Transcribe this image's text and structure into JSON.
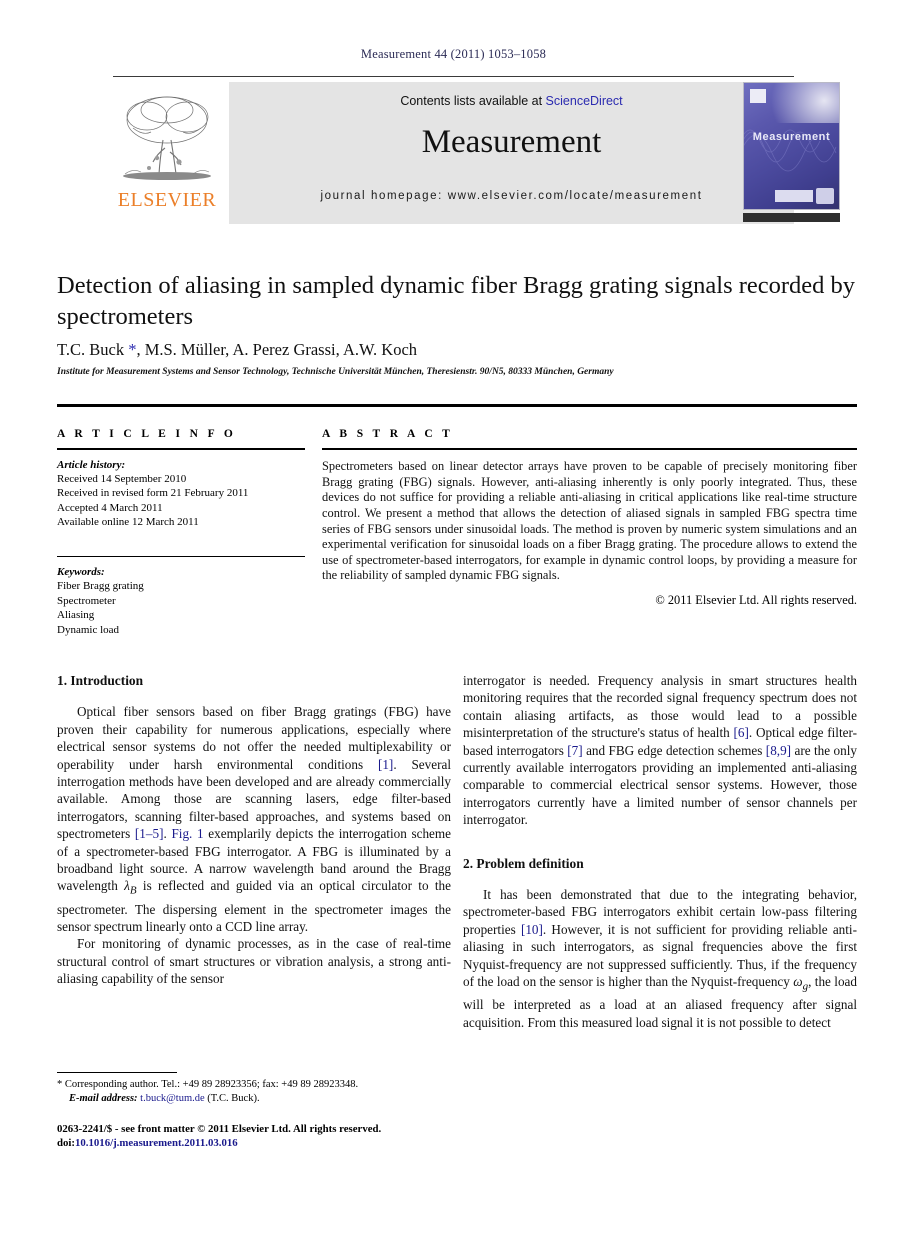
{
  "running_head": "Measurement 44 (2011) 1053–1058",
  "masthead": {
    "contents_prefix": "Contents lists available at ",
    "contents_link": "ScienceDirect",
    "journal_title": "Measurement",
    "homepage": "journal homepage: www.elsevier.com/locate/measurement",
    "publisher_logo_text": "ELSEVIER",
    "cover_title": "Measurement"
  },
  "article": {
    "title": "Detection of aliasing in sampled dynamic fiber Bragg grating signals recorded by spectrometers",
    "authors": "T.C. Buck ",
    "author_star": "*",
    "authors_rest": ", M.S. Müller, A. Perez Grassi, A.W. Koch",
    "affiliation": "Institute for Measurement Systems and Sensor Technology, Technische Universität München, Theresienstr. 90/N5, 80333 München, Germany"
  },
  "info": {
    "heading": "A R T I C L E   I N F O",
    "history_label": "Article history:",
    "history": [
      "Received 14 September 2010",
      "Received in revised form 21 February 2011",
      "Accepted 4 March 2011",
      "Available online 12 March 2011"
    ],
    "keywords_label": "Keywords:",
    "keywords": [
      "Fiber Bragg grating",
      "Spectrometer",
      "Aliasing",
      "Dynamic load"
    ]
  },
  "abstract": {
    "heading": "A B S T R A C T",
    "text": "Spectrometers based on linear detector arrays have proven to be capable of precisely monitoring fiber Bragg grating (FBG) signals. However, anti-aliasing inherently is only poorly integrated. Thus, these devices do not suffice for providing a reliable anti-aliasing in critical applications like real-time structure control. We present a method that allows the detection of aliased signals in sampled FBG spectra time series of FBG sensors under sinusoidal loads. The method is proven by numeric system simulations and an experimental verification for sinusoidal loads on a fiber Bragg grating. The procedure allows to extend the use of spectrometer-based interrogators, for example in dynamic control loops, by providing a measure for the reliability of sampled dynamic FBG signals.",
    "copyright": "© 2011 Elsevier Ltd. All rights reserved."
  },
  "body": {
    "section1_title": "1. Introduction",
    "s1_p1_a": "Optical fiber sensors based on fiber Bragg gratings (FBG) have proven their capability for numerous applications, especially where electrical sensor systems do not offer the needed multiplexability or operability under harsh environmental conditions ",
    "s1_p1_ref1": "[1]",
    "s1_p1_b": ". Several interrogation methods have been developed and are already commercially available. Among those are scanning lasers, edge filter-based interrogators, scanning filter-based approaches, and systems based on spectrometers ",
    "s1_p1_ref2": "[1–5]",
    "s1_p1_c": ". ",
    "s1_p1_ref3": "Fig. 1",
    "s1_p1_d": " exemplarily depicts the interrogation scheme of a spectrometer-based FBG interrogator. A FBG is illuminated by a broadband light source. A narrow wavelength band around the Bragg wavelength ",
    "s1_p1_sym": "λ",
    "s1_p1_sub": "B",
    "s1_p1_e": " is reflected and guided via an optical circulator to the spectrometer. The dispersing element in the spectrometer images the sensor spectrum linearly onto a CCD line array.",
    "s1_p2": "For monitoring of dynamic processes, as in the case of real-time structural control of smart structures or vibration analysis, a strong anti-aliasing capability of the sensor",
    "s1_p3_a": "interrogator is needed. Frequency analysis in smart structures health monitoring requires that the recorded signal frequency spectrum does not contain aliasing artifacts, as those would lead to a possible misinterpretation of the structure's status of health ",
    "s1_p3_ref6": "[6]",
    "s1_p3_b": ". Optical edge filter-based interrogators ",
    "s1_p3_ref7": "[7]",
    "s1_p3_c": " and FBG edge detection schemes ",
    "s1_p3_ref89": "[8,9]",
    "s1_p3_d": " are the only currently available interrogators providing an implemented anti-aliasing comparable to commercial electrical sensor systems. However, those interrogators currently have a limited number of sensor channels per interrogator.",
    "section2_title": "2. Problem definition",
    "s2_p1_a": "It has been demonstrated that due to the integrating behavior, spectrometer-based FBG interrogators exhibit certain low-pass filtering properties ",
    "s2_p1_ref10": "[10]",
    "s2_p1_b": ". However, it is not sufficient for providing reliable anti-aliasing in such interrogators, as signal frequencies above the first Nyquist-frequency are not suppressed sufficiently. Thus, if the frequency of the load on the sensor is higher than the Nyquist-frequency ",
    "s2_p1_sym": "ω",
    "s2_p1_sub": "g",
    "s2_p1_c": ", the load will be interpreted as a load at an aliased frequency after signal acquisition. From this measured load signal it is not possible to detect"
  },
  "footnote": {
    "star": "*",
    "line1": " Corresponding author. Tel.: +49 89 28923356; fax: +49 89 28923348.",
    "email_label": "E-mail address:",
    "email": "t.buck@tum.de",
    "email_owner": " (T.C. Buck)."
  },
  "imprint": {
    "line1": "0263-2241/$ - see front matter © 2011 Elsevier Ltd. All rights reserved.",
    "doi_label": "doi:",
    "doi": "10.1016/j.measurement.2011.03.016"
  },
  "colors": {
    "link": "#1a1a8c",
    "sciencedirect": "#2b2bb0",
    "elsevier_orange": "#eb7f29",
    "band": "#e4e4e4",
    "cover": "#4b4a9e"
  }
}
